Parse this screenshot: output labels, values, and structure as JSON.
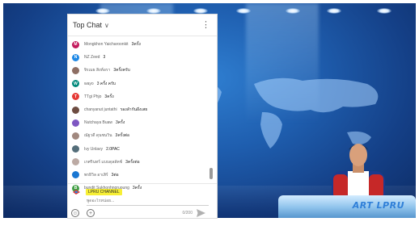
{
  "chat": {
    "title": "Top Chat",
    "caret": "∨",
    "menu": "⋮",
    "messages": [
      {
        "author": "Mongkhon Yaicharoonkit",
        "text": "3ครั้ง",
        "color": "#c2185b",
        "initial": "M"
      },
      {
        "author": "NZ Zeed",
        "text": "3",
        "color": "#1e88e5",
        "initial": "N"
      },
      {
        "author": "จิรเมธ สิงห์อรา",
        "text": "3ครั้งครับ",
        "color": "#8d6e63",
        "initial": ""
      },
      {
        "author": "wayo",
        "text": "3 ครั้ง ครับ",
        "color": "#00897b",
        "initial": "W"
      },
      {
        "author": "TTgi Phjo",
        "text": "3ครั้ง",
        "color": "#e53935",
        "initial": "T"
      },
      {
        "author": "chanyanut juntathi",
        "text": "รองลำกันอีงเสย",
        "color": "#6d4c41",
        "initial": ""
      },
      {
        "author": "Nutchaya Buaw",
        "text": "3ครั้ง",
        "color": "#7e57c2",
        "initial": ""
      },
      {
        "author": "ณัฐวดี ดุนชนวิน",
        "text": "3ครั้งต่อ",
        "color": "#a1887f",
        "initial": ""
      },
      {
        "author": "Ivy Unlavy",
        "text": "2.0PAC",
        "color": "#546e7a",
        "initial": ""
      },
      {
        "author": "เกศรินทร์ แบบดุลลัคช์",
        "text": "3ครั้งต่อ",
        "color": "#bcaaa4",
        "initial": ""
      },
      {
        "author": "พรธิวิล อาเสิร์",
        "text": "3ต่อ",
        "color": "#1976d2",
        "initial": ""
      },
      {
        "author": "bundit Sukhonhngruoung",
        "text": "3ครั้ง",
        "color": "#43a047",
        "initial": "B"
      }
    ],
    "channel_name": "LPRU CHANNEL",
    "input_placeholder": "พูดอะไรหน่อย...",
    "char_counter": "0/200",
    "emoji_icon": "☺",
    "add_icon": "+",
    "send_icon": "send-icon"
  },
  "studio": {
    "desk_logo": "ART LPRU"
  }
}
